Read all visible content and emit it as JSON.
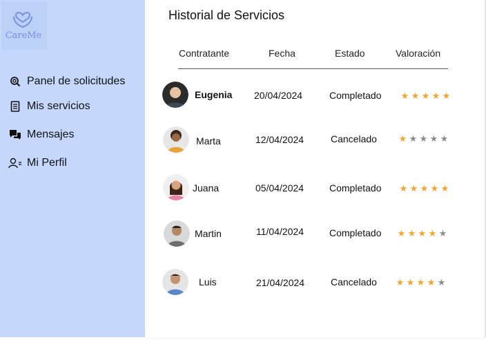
{
  "brand": {
    "name": "CareMe"
  },
  "colors": {
    "sidebar": "#c5d7fb",
    "accent": "#7b8fe0",
    "star_on": "#f5a32a",
    "star_off": "#8b8b8b"
  },
  "sidebar": {
    "items": [
      {
        "label": "Panel de solicitudes",
        "icon": "search-document-icon"
      },
      {
        "label": "Mis servicios",
        "icon": "list-document-icon"
      },
      {
        "label": "Mensajes",
        "icon": "chat-bubbles-icon"
      },
      {
        "label": "Mi Perfil",
        "icon": "user-profile-icon"
      }
    ]
  },
  "main": {
    "title": "Historial de Servicios",
    "columns": [
      "Contratante",
      "Fecha",
      "Estado",
      "Valoración"
    ],
    "rows": [
      {
        "name": "Eugenia",
        "date": "20/04/2024",
        "status": "Completado",
        "rating": 5
      },
      {
        "name": "Marta",
        "date": "12/04/2024",
        "status": "Cancelado",
        "rating": 1
      },
      {
        "name": "Juana",
        "date": "05/04/2024",
        "status": "Completado",
        "rating": 5
      },
      {
        "name": "Martin",
        "date": "11/04/2024",
        "status": "Completado",
        "rating": 4
      },
      {
        "name": "Luis",
        "date": "21/04/2024",
        "status": "Cancelado",
        "rating": 4
      }
    ]
  }
}
